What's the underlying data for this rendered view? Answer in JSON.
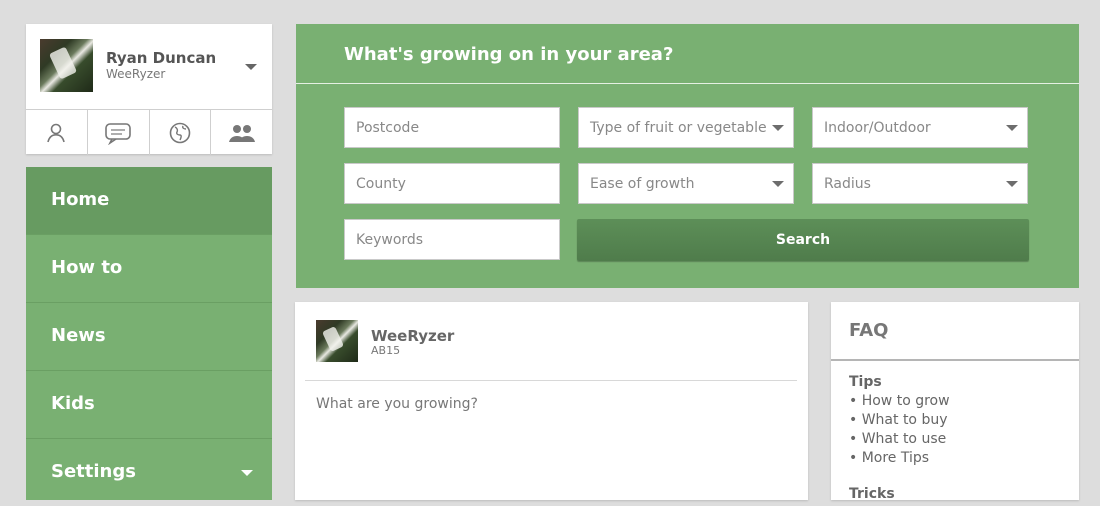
{
  "profile": {
    "name": "Ryan Duncan",
    "handle": "WeeRyzer"
  },
  "profile_actions": [
    "user-icon",
    "chat-icon",
    "globe-icon",
    "group-icon"
  ],
  "nav": {
    "items": [
      "Home",
      "How to",
      "News",
      "Kids",
      "Settings"
    ],
    "active": "Home"
  },
  "search": {
    "title": "What's growing on in your area?",
    "postcode_placeholder": "Postcode",
    "type_placeholder": "Type of fruit or vegetable",
    "location_placeholder": "Indoor/Outdoor",
    "county_placeholder": "County",
    "ease_placeholder": "Ease of growth",
    "radius_placeholder": "Radius",
    "keywords_placeholder": "Keywords",
    "search_label": "Search"
  },
  "post": {
    "user": "WeeRyzer",
    "location": "AB15",
    "placeholder": "What are you growing?"
  },
  "faq": {
    "title": "FAQ",
    "sections": [
      {
        "title": "Tips",
        "links": [
          "• How to grow",
          "• What to buy",
          "• What to use",
          "• More Tips"
        ]
      },
      {
        "title": "Tricks",
        "links": []
      }
    ]
  },
  "colors": {
    "accent": "#79b072",
    "nav_active": "#679b61",
    "button": "#5d8f58"
  }
}
